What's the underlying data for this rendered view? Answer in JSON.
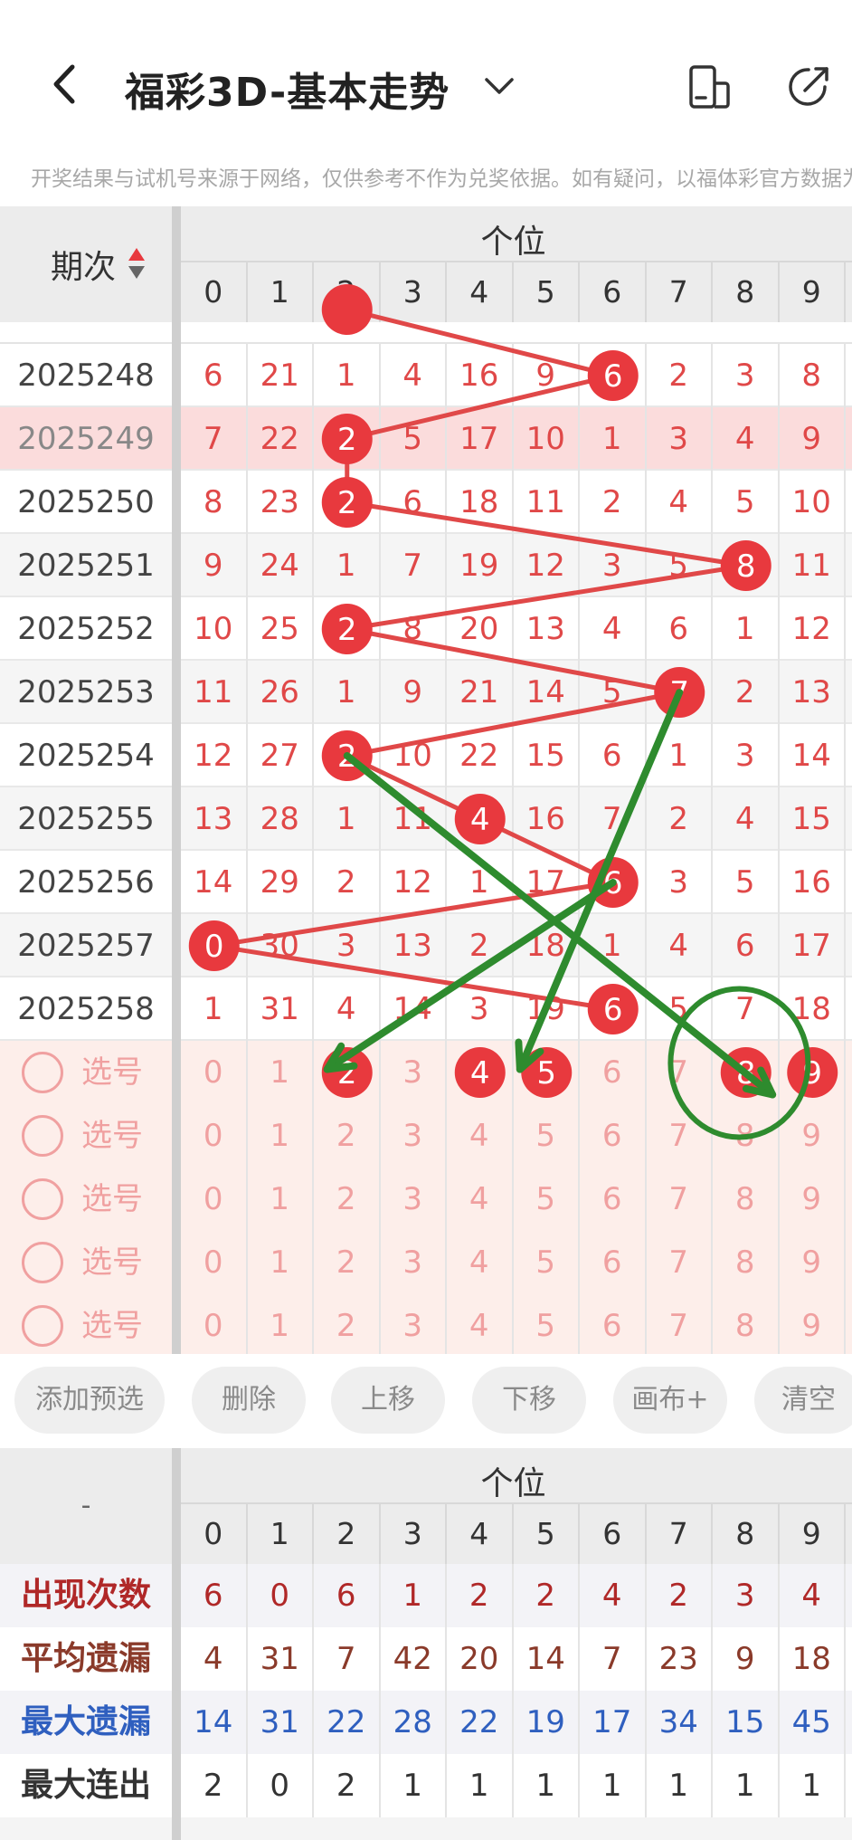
{
  "header": {
    "title": "福彩3D-基本走势",
    "notice": "开奖结果与试机号来源于网络，仅供参考不作为兑奖依据。如有疑问，以福体彩官方数据为准"
  },
  "table": {
    "period_label": "期次",
    "group_label": "个位",
    "digits": [
      "0",
      "1",
      "2",
      "3",
      "4",
      "5",
      "6",
      "7",
      "8",
      "9"
    ],
    "rows": [
      {
        "period": "2025248",
        "win": 6,
        "cells": [
          "6",
          "21",
          "1",
          "4",
          "16",
          "9",
          "6",
          "2",
          "3",
          "8"
        ]
      },
      {
        "period": "2025249",
        "win": 2,
        "cells": [
          "7",
          "22",
          "2",
          "5",
          "17",
          "10",
          "1",
          "3",
          "4",
          "9"
        ]
      },
      {
        "period": "2025250",
        "win": 2,
        "cells": [
          "8",
          "23",
          "2",
          "6",
          "18",
          "11",
          "2",
          "4",
          "5",
          "10"
        ]
      },
      {
        "period": "2025251",
        "win": 8,
        "cells": [
          "9",
          "24",
          "1",
          "7",
          "19",
          "12",
          "3",
          "5",
          "8",
          "11"
        ]
      },
      {
        "period": "2025252",
        "win": 2,
        "cells": [
          "10",
          "25",
          "2",
          "8",
          "20",
          "13",
          "4",
          "6",
          "1",
          "12"
        ]
      },
      {
        "period": "2025253",
        "win": 7,
        "cells": [
          "11",
          "26",
          "1",
          "9",
          "21",
          "14",
          "5",
          "7",
          "2",
          "13"
        ]
      },
      {
        "period": "2025254",
        "win": 2,
        "cells": [
          "12",
          "27",
          "2",
          "10",
          "22",
          "15",
          "6",
          "1",
          "3",
          "14"
        ]
      },
      {
        "period": "2025255",
        "win": 4,
        "cells": [
          "13",
          "28",
          "1",
          "11",
          "4",
          "16",
          "7",
          "2",
          "4",
          "15"
        ]
      },
      {
        "period": "2025256",
        "win": 6,
        "cells": [
          "14",
          "29",
          "2",
          "12",
          "1",
          "17",
          "6",
          "3",
          "5",
          "16"
        ]
      },
      {
        "period": "2025257",
        "win": 0,
        "cells": [
          "0",
          "30",
          "3",
          "13",
          "2",
          "18",
          "1",
          "4",
          "6",
          "17"
        ]
      },
      {
        "period": "2025258",
        "win": 6,
        "cells": [
          "1",
          "31",
          "4",
          "14",
          "3",
          "19",
          "6",
          "5",
          "7",
          "18"
        ]
      }
    ],
    "pick_label": "选号",
    "pick_rows": [
      {
        "selected": [
          2,
          4,
          5,
          8,
          9
        ]
      },
      {
        "selected": []
      },
      {
        "selected": []
      },
      {
        "selected": []
      },
      {
        "selected": []
      }
    ]
  },
  "toolbar": {
    "buttons": [
      "添加预选",
      "删除",
      "上移",
      "下移",
      "画布+",
      "清空"
    ]
  },
  "stats": {
    "dash": "-",
    "group_label": "个位",
    "digits": [
      "0",
      "1",
      "2",
      "3",
      "4",
      "5",
      "6",
      "7",
      "8",
      "9"
    ],
    "rows": [
      {
        "label": "出现次数",
        "color": "#b02828",
        "values": [
          "6",
          "0",
          "6",
          "1",
          "2",
          "2",
          "4",
          "2",
          "3",
          "4"
        ]
      },
      {
        "label": "平均遗漏",
        "color": "#8a3a2a",
        "values": [
          "4",
          "31",
          "7",
          "42",
          "20",
          "14",
          "7",
          "23",
          "9",
          "18"
        ]
      },
      {
        "label": "最大遗漏",
        "color": "#2f5fbf",
        "values": [
          "14",
          "31",
          "22",
          "28",
          "22",
          "19",
          "17",
          "34",
          "15",
          "45"
        ]
      },
      {
        "label": "最大连出",
        "color": "#333333",
        "values": [
          "2",
          "0",
          "2",
          "1",
          "1",
          "1",
          "1",
          "1",
          "1",
          "1"
        ]
      }
    ]
  },
  "colors": {
    "ball": "#e8393e",
    "trend_line": "#e04848",
    "annotation": "#2e8b2e",
    "highlight_row": "#fbdcdc",
    "pick_bg": "#fdeeea"
  }
}
